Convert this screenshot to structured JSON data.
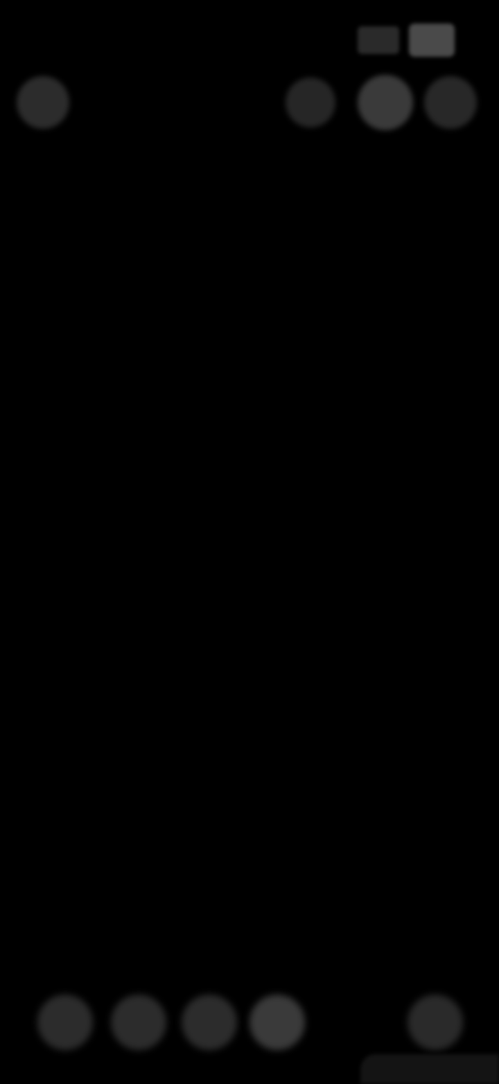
{
  "status_bar": {
    "time": "",
    "icons": [
      "signal-icon",
      "battery-icon"
    ]
  },
  "toolbar": {
    "buttons": [
      "back-icon",
      "undo-icon",
      "share-icon",
      "more-icon"
    ]
  },
  "note": {
    "title": "",
    "body": ""
  },
  "bottom_toolbar": {
    "buttons": [
      "checklist-icon",
      "format-icon",
      "image-icon",
      "draw-icon",
      "edit-icon"
    ]
  },
  "colors": {
    "background": "#000000",
    "text": "#9a9a9a",
    "button": "#2c2c2c"
  }
}
